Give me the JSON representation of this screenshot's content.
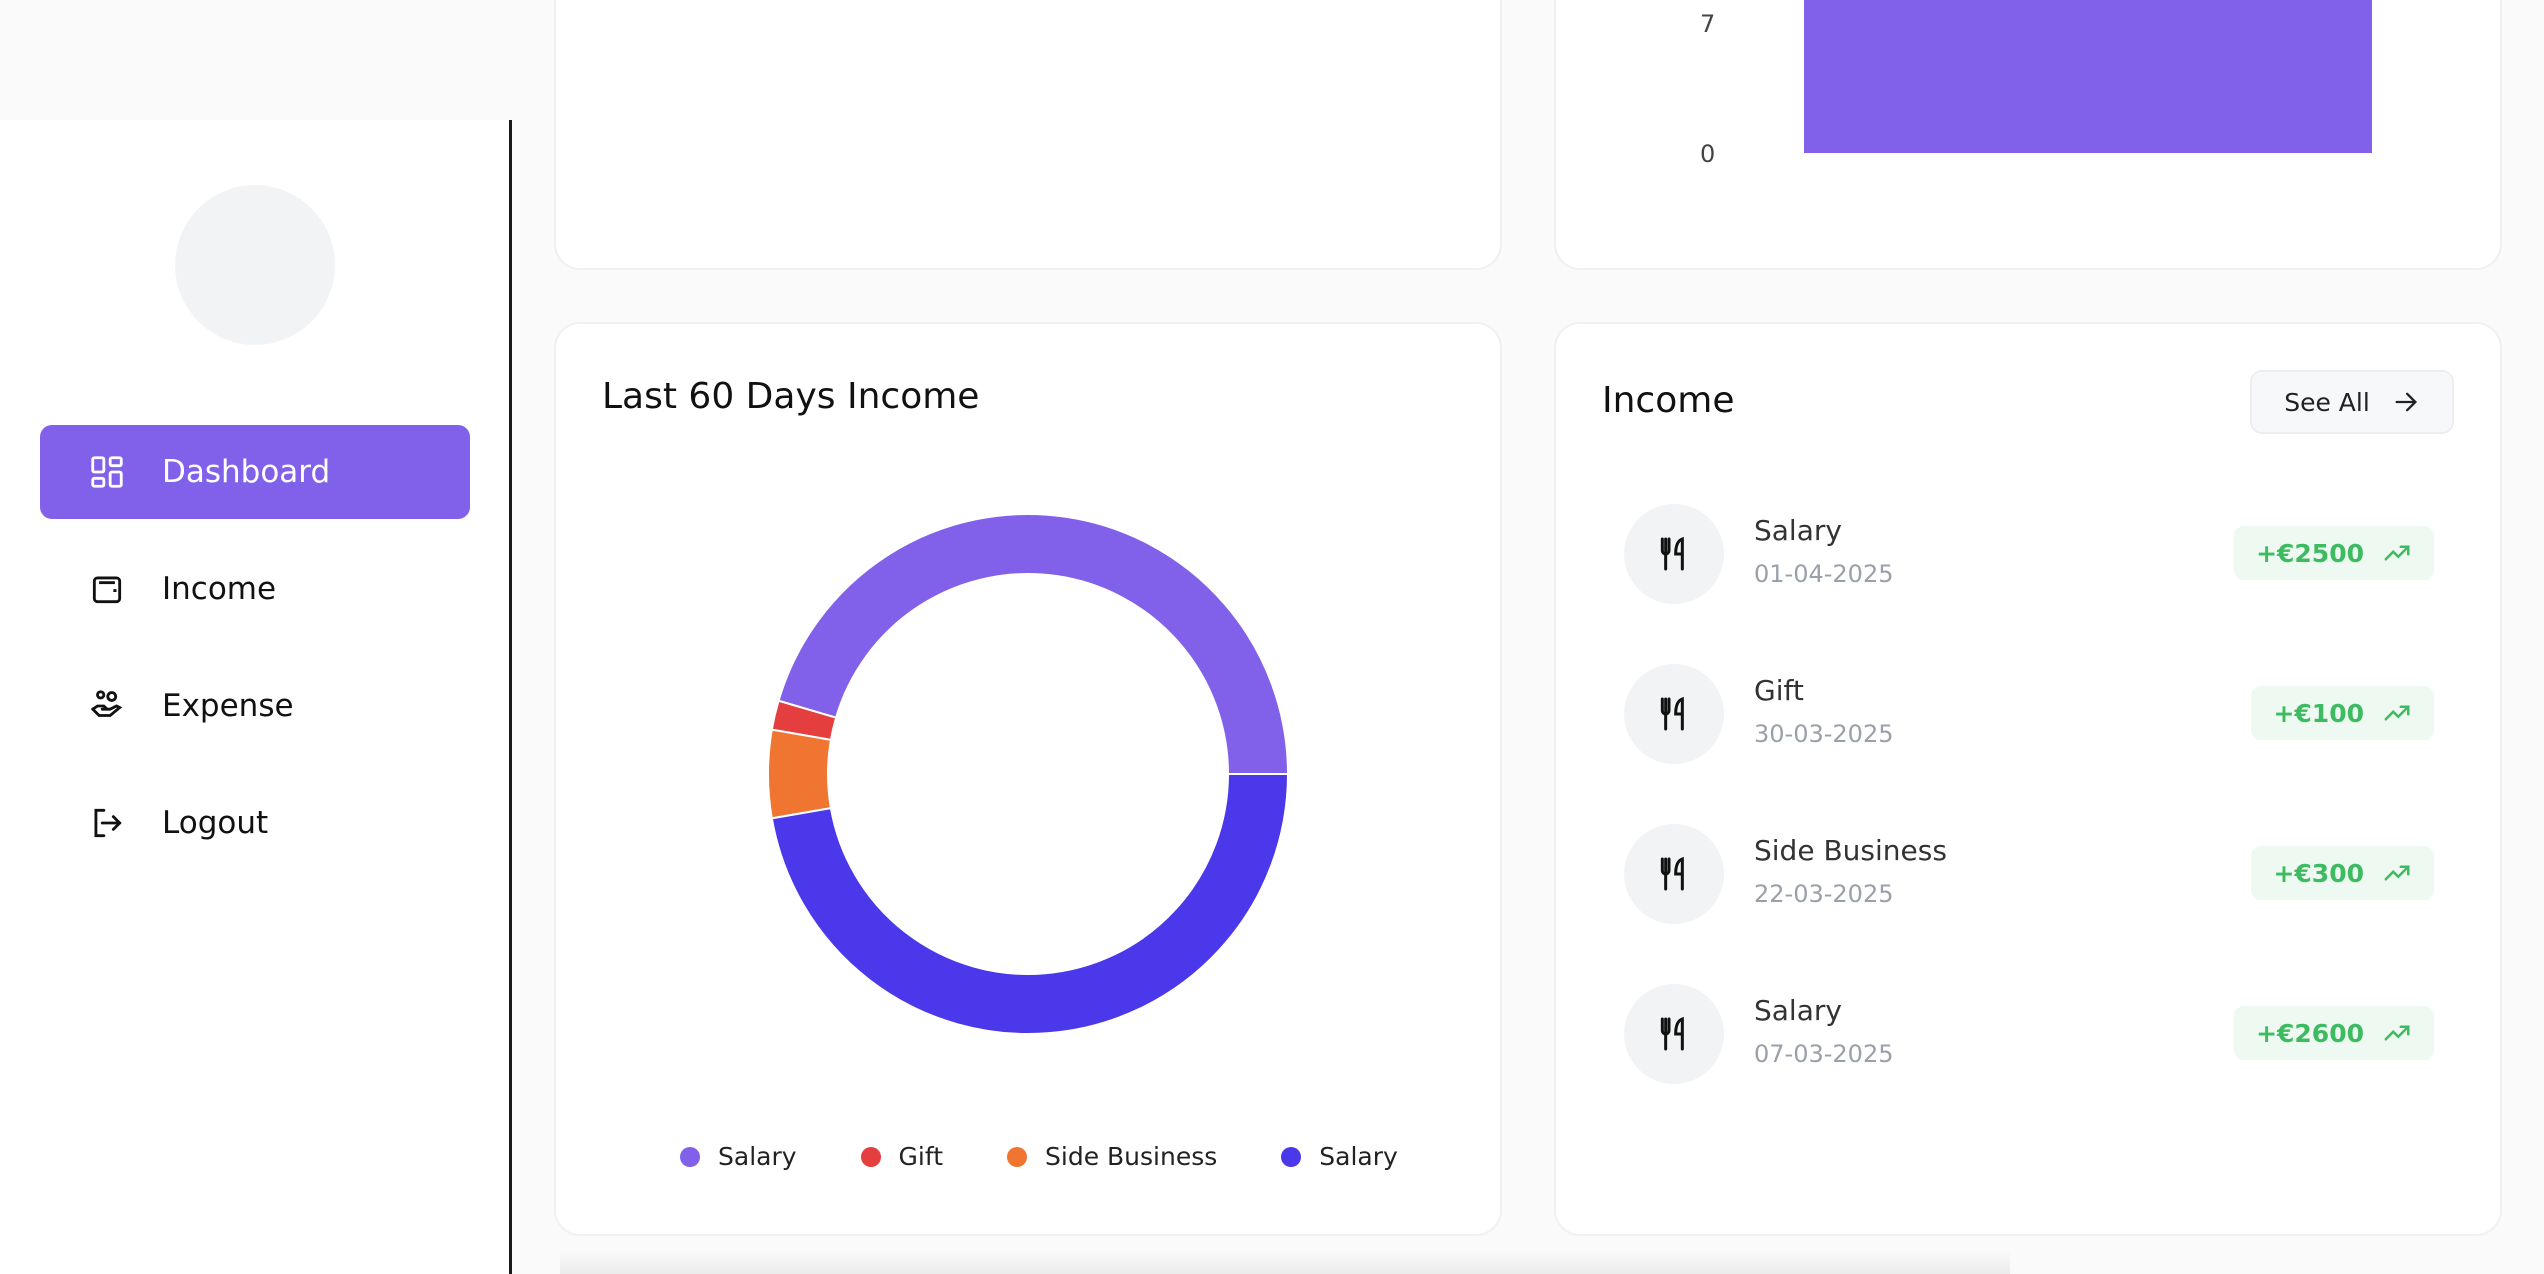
{
  "sidebar": {
    "items": [
      {
        "label": "Dashboard",
        "icon": "dashboard-grid-icon",
        "active": true
      },
      {
        "label": "Income",
        "icon": "wallet-icon",
        "active": false
      },
      {
        "label": "Expense",
        "icon": "hand-coins-icon",
        "active": false
      },
      {
        "label": "Logout",
        "icon": "logout-icon",
        "active": false
      }
    ]
  },
  "top_bar_chart": {
    "ticks": [
      "7",
      "0"
    ]
  },
  "income_pie": {
    "title": "Last 60 Days Income",
    "chart_data": {
      "type": "pie",
      "style": "donut",
      "categories": [
        "Salary",
        "Gift",
        "Side Business",
        "Salary"
      ],
      "values": [
        2500,
        100,
        300,
        2600
      ],
      "colors": [
        "#8160ea",
        "#e53e3e",
        "#f07530",
        "#4a38ea"
      ]
    }
  },
  "income_list": {
    "title": "Income",
    "see_all_label": "See All",
    "items": [
      {
        "name": "Salary",
        "date": "01-04-2025",
        "amount": "+€2500"
      },
      {
        "name": "Gift",
        "date": "30-03-2025",
        "amount": "+€100"
      },
      {
        "name": "Side Business",
        "date": "22-03-2025",
        "amount": "+€300"
      },
      {
        "name": "Salary",
        "date": "07-03-2025",
        "amount": "+€2600"
      }
    ]
  },
  "colors": {
    "accent": "#8160ea",
    "income_green": "#3dbb60"
  }
}
